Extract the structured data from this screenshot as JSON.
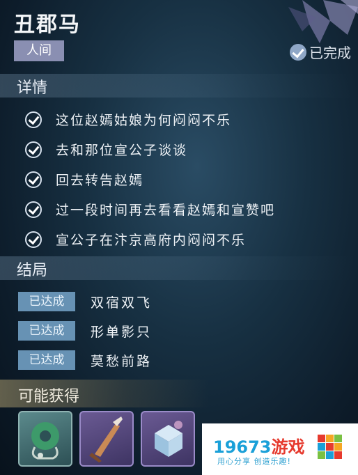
{
  "quest": {
    "title": "丑郡马",
    "region_tag": "人间",
    "status_label": "已完成"
  },
  "details": {
    "heading": "详情",
    "items": [
      "这位赵嫣姑娘为何闷闷不乐",
      "去和那位宣公子谈谈",
      "回去转告赵嫣",
      "过一段时间再去看看赵嫣和宣赞吧",
      "宣公子在汴京高府内闷闷不乐"
    ]
  },
  "endings": {
    "heading": "结局",
    "achieved_label": "已达成",
    "items": [
      "双宿双飞",
      "形单影只",
      "莫愁前路"
    ]
  },
  "rewards": {
    "heading": "可能获得",
    "items": [
      {
        "icon": "jade-pendant-icon"
      },
      {
        "icon": "dagger-icon"
      },
      {
        "icon": "ice-cube-icon"
      }
    ]
  },
  "watermark": {
    "brand_number": "19673",
    "brand_word": "游戏",
    "slogan": "用心分享 创造乐趣!"
  },
  "colors": {
    "region_tag": "#8a8fb2",
    "achieved_tag": "#6792b4",
    "background": "#173042"
  }
}
